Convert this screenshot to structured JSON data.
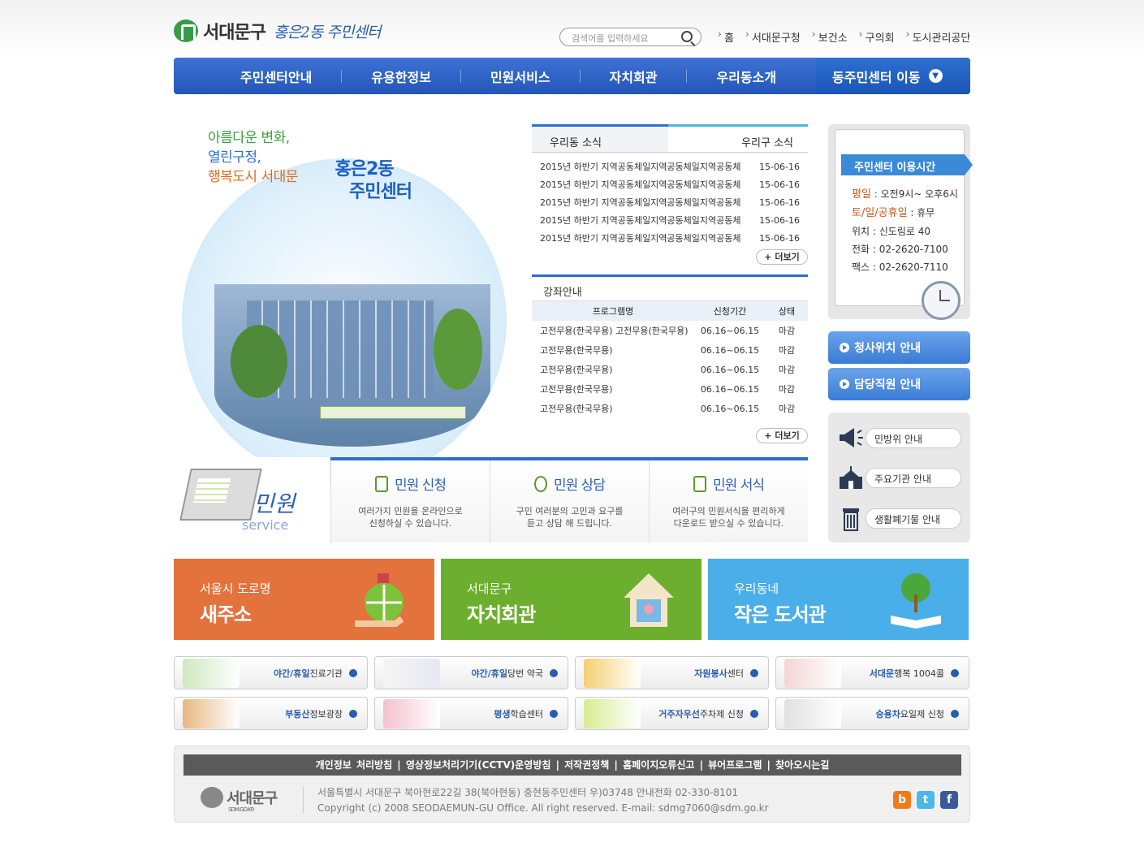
{
  "header": {
    "brand": "서대문구",
    "center_name": "홍은2동 주민센터",
    "search_placeholder": "검색어를 입력하세요",
    "top_links": [
      "홈",
      "서대문구청",
      "보건소",
      "구의회",
      "도시관리공단"
    ]
  },
  "nav": {
    "items": [
      "주민센터안내",
      "유용한정보",
      "민원서비스",
      "자치회관",
      "우리동소개"
    ],
    "move_label": "동주민센터 이동"
  },
  "visual": {
    "slogan": [
      "아름다운 변화,",
      "열린구정,",
      "행복도시 서대문"
    ],
    "title": [
      "홍은2동",
      "주민센터"
    ]
  },
  "news": {
    "tab_active": "우리동 소식",
    "tab_other": "우리구 소식",
    "items": [
      {
        "title": "2015년 하반기 지역공동체일지역공동체일지역공동체",
        "date": "15-06-16"
      },
      {
        "title": "2015년 하반기 지역공동체일지역공동체일지역공동체",
        "date": "15-06-16"
      },
      {
        "title": "2015년 하반기 지역공동체일지역공동체일지역공동체",
        "date": "15-06-16"
      },
      {
        "title": "2015년 하반기 지역공동체일지역공동체일지역공동체",
        "date": "15-06-16"
      },
      {
        "title": "2015년 하반기 지역공동체일지역공동체일지역공동체",
        "date": "15-06-16"
      }
    ],
    "more": "+ 더보기"
  },
  "lecture": {
    "title": "강좌안내",
    "headers": [
      "프로그램명",
      "신청기간",
      "상태"
    ],
    "rows": [
      {
        "name": "고전무용(한국무용) 고전무용(한국무용)",
        "period": "06.16~06.15",
        "status": "마감"
      },
      {
        "name": "고전무용(한국무용)",
        "period": "06.16~06.15",
        "status": "마감"
      },
      {
        "name": "고전무용(한국무용)",
        "period": "06.16~06.15",
        "status": "마감"
      },
      {
        "name": "고전무용(한국무용)",
        "period": "06.16~06.15",
        "status": "마감"
      },
      {
        "name": "고전무용(한국무용)",
        "period": "06.16~06.15",
        "status": "마감"
      }
    ],
    "more": "+ 더보기"
  },
  "hours": {
    "title": "주민센터 이용시간",
    "weekday_label": "평일",
    "weekday_value": " : 오전9시~ 오후6시",
    "weekend_label": "토/일/공휴일",
    "weekend_value": " : 휴무",
    "address": "위치 : 신도림로 40",
    "phone": "전화 : 02-2620-7100",
    "fax": "팩스 : 02-2620-7110"
  },
  "side_buttons": [
    "청사위치 안내",
    "담당직원 안내"
  ],
  "side_links": [
    "민방위 안내",
    "주요기관 안내",
    "생활폐기물 안내"
  ],
  "service": {
    "title": "민원",
    "subtitle": "service",
    "cols": [
      {
        "title": "민원 신청",
        "desc": [
          "여러가지 민원을 온라인으로",
          "신청하실 수 있습니다."
        ]
      },
      {
        "title": "민원 상담",
        "desc": [
          "구민 여러분의 고민과 요구를",
          "듣고 상담 해 드립니다."
        ]
      },
      {
        "title": "민원 서식",
        "desc": [
          "여러구의 민원서식을 편리하게",
          "다운로드 받으실 수 있습니다."
        ]
      }
    ]
  },
  "banners": [
    {
      "small": "서울시 도로명",
      "big": "새주소",
      "color": "#e3723c"
    },
    {
      "small": "서대문구",
      "big": "자치회관",
      "color": "#6cae2e"
    },
    {
      "small": "우리동네",
      "big": "작은 도서관",
      "color": "#4aaee8"
    }
  ],
  "quick_links": [
    {
      "hl": "야간/휴일",
      "rest": " 진료기관"
    },
    {
      "hl": "야간/휴일",
      "rest": " 당번 약국"
    },
    {
      "hl": "자원봉사",
      "rest": "센터"
    },
    {
      "hl": "서대문",
      "rest": " 행복 1004콜"
    },
    {
      "hl": "부동산",
      "rest": " 정보광장"
    },
    {
      "hl": "평생",
      "rest": "학습센터"
    },
    {
      "hl": "거주자우선",
      "rest": " 주차제 신청"
    },
    {
      "hl": "승용차",
      "rest": " 요일제 신청"
    }
  ],
  "footer": {
    "links": "개인정보 처리방침   |   영상정보처리기기(CCTV)운영방침   |   저작권정책   |   홈페이지오류신고   |   뷰어프로그램   |   찾아오시는길",
    "logo": "서대문구",
    "logo_sub": "SDM.GO.KR",
    "address": "서울특별시 서대문구 북아현로22길 38(북아현동) 충현동주민센터 우)03748 안내전화 02-330-8101",
    "copyright": "Copyright (c) 2008 SEODAEMUN-GU Office. All right reserved. E-mail: sdmg7060@sdm.go.kr"
  }
}
